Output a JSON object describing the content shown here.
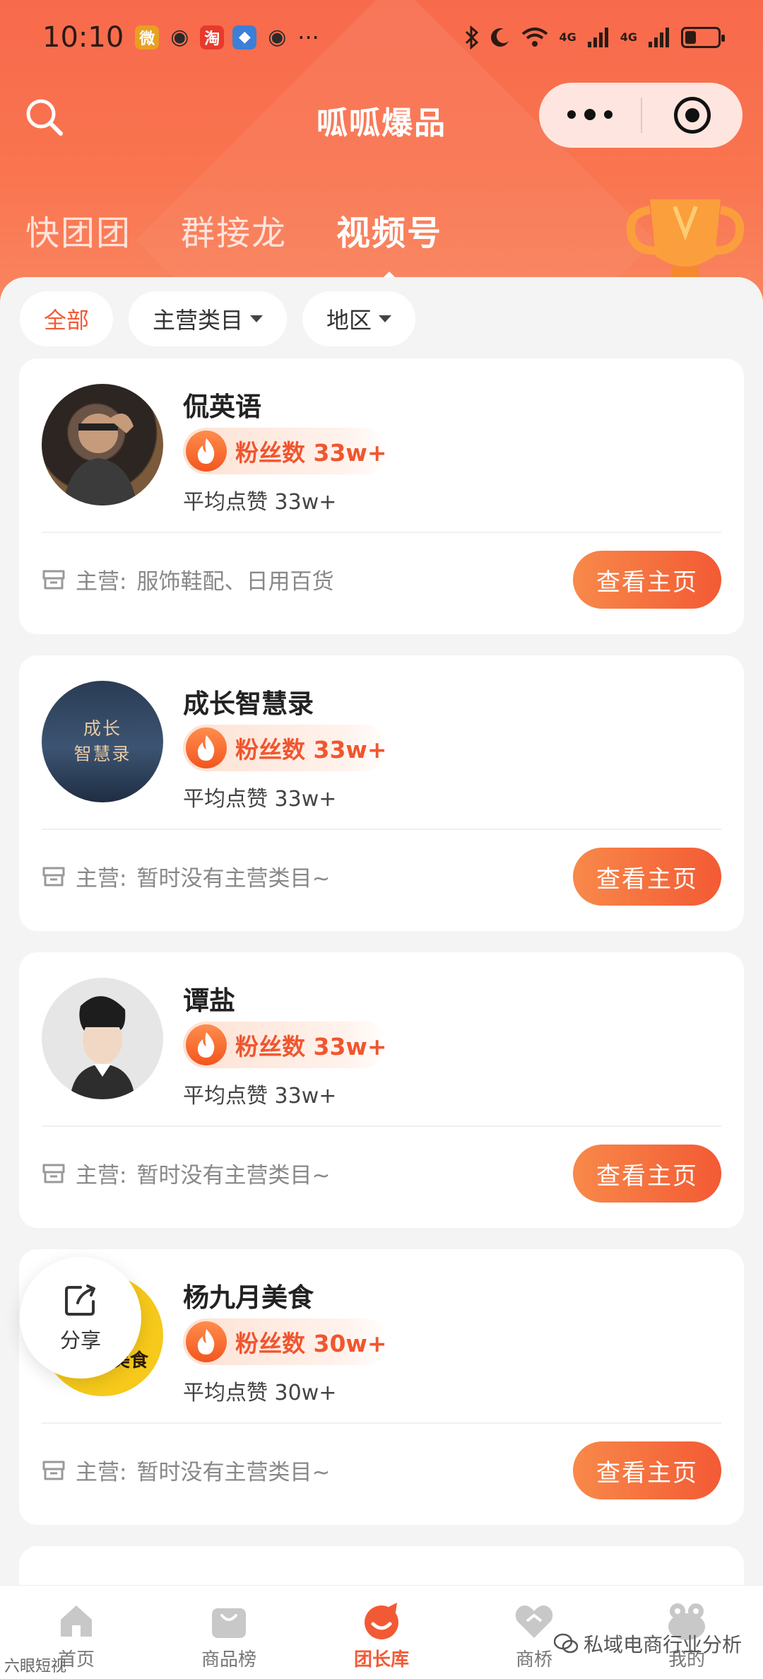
{
  "status_bar": {
    "time": "10:10",
    "apps": [
      {
        "icon": "weibo-icon",
        "glyph": "微",
        "color": "#e8a020"
      },
      {
        "icon": "wechat-icon",
        "glyph": "◉",
        "color": "#2a2a2a"
      },
      {
        "icon": "taobao-icon",
        "glyph": "淘",
        "color": "#e8392b"
      },
      {
        "icon": "browser-icon",
        "glyph": "◆",
        "color": "#3c7fd6"
      },
      {
        "icon": "wechat-icon",
        "glyph": "◉",
        "color": "#2a2a2a"
      }
    ],
    "more": "···",
    "network_1": "4G",
    "network_2": "4G",
    "battery_level": 0.35
  },
  "nav": {
    "title": "呱呱爆品"
  },
  "tabs": [
    {
      "label": "快团团",
      "active": false
    },
    {
      "label": "群接龙",
      "active": false
    },
    {
      "label": "视频号",
      "active": true
    }
  ],
  "filters": [
    {
      "label": "全部",
      "active": true,
      "dropdown": false
    },
    {
      "label": "主营类目",
      "active": false,
      "dropdown": true
    },
    {
      "label": "地区",
      "active": false,
      "dropdown": true
    }
  ],
  "cards": [
    {
      "name": "侃英语",
      "fans": "粉丝数 33w+",
      "likes": "平均点赞 33w+",
      "main_label": "主营:",
      "main_value": "服饰鞋配、日用百货",
      "button": "查看主页",
      "avatar_text": ""
    },
    {
      "name": "成长智慧录",
      "fans": "粉丝数 33w+",
      "likes": "平均点赞 33w+",
      "main_label": "主营:",
      "main_value": "暂时没有主营类目~",
      "button": "查看主页",
      "avatar_text_1": "成长",
      "avatar_text_2": "智慧录"
    },
    {
      "name": "谭盐",
      "fans": "粉丝数 33w+",
      "likes": "平均点赞 33w+",
      "main_label": "主营:",
      "main_value": "暂时没有主营类目~",
      "button": "查看主页"
    },
    {
      "name": "杨九月美食",
      "fans": "粉丝数 30w+",
      "likes": "平均点赞 30w+",
      "main_label": "主营:",
      "main_value": "暂时没有主营类目~",
      "button": "查看主页",
      "avatar_text": "杨九月美食"
    }
  ],
  "share": {
    "label": "分享"
  },
  "tabbar": [
    {
      "label": "首页",
      "icon": "home-icon",
      "active": false
    },
    {
      "label": "商品榜",
      "icon": "bag-icon",
      "active": false
    },
    {
      "label": "团长库",
      "icon": "leader-icon",
      "active": true
    },
    {
      "label": "商桥",
      "icon": "bridge-icon",
      "active": false
    },
    {
      "label": "我的",
      "icon": "frog-icon",
      "active": false
    }
  ],
  "watermark": "私域电商行业分析",
  "watermark_left": "六眼短视"
}
